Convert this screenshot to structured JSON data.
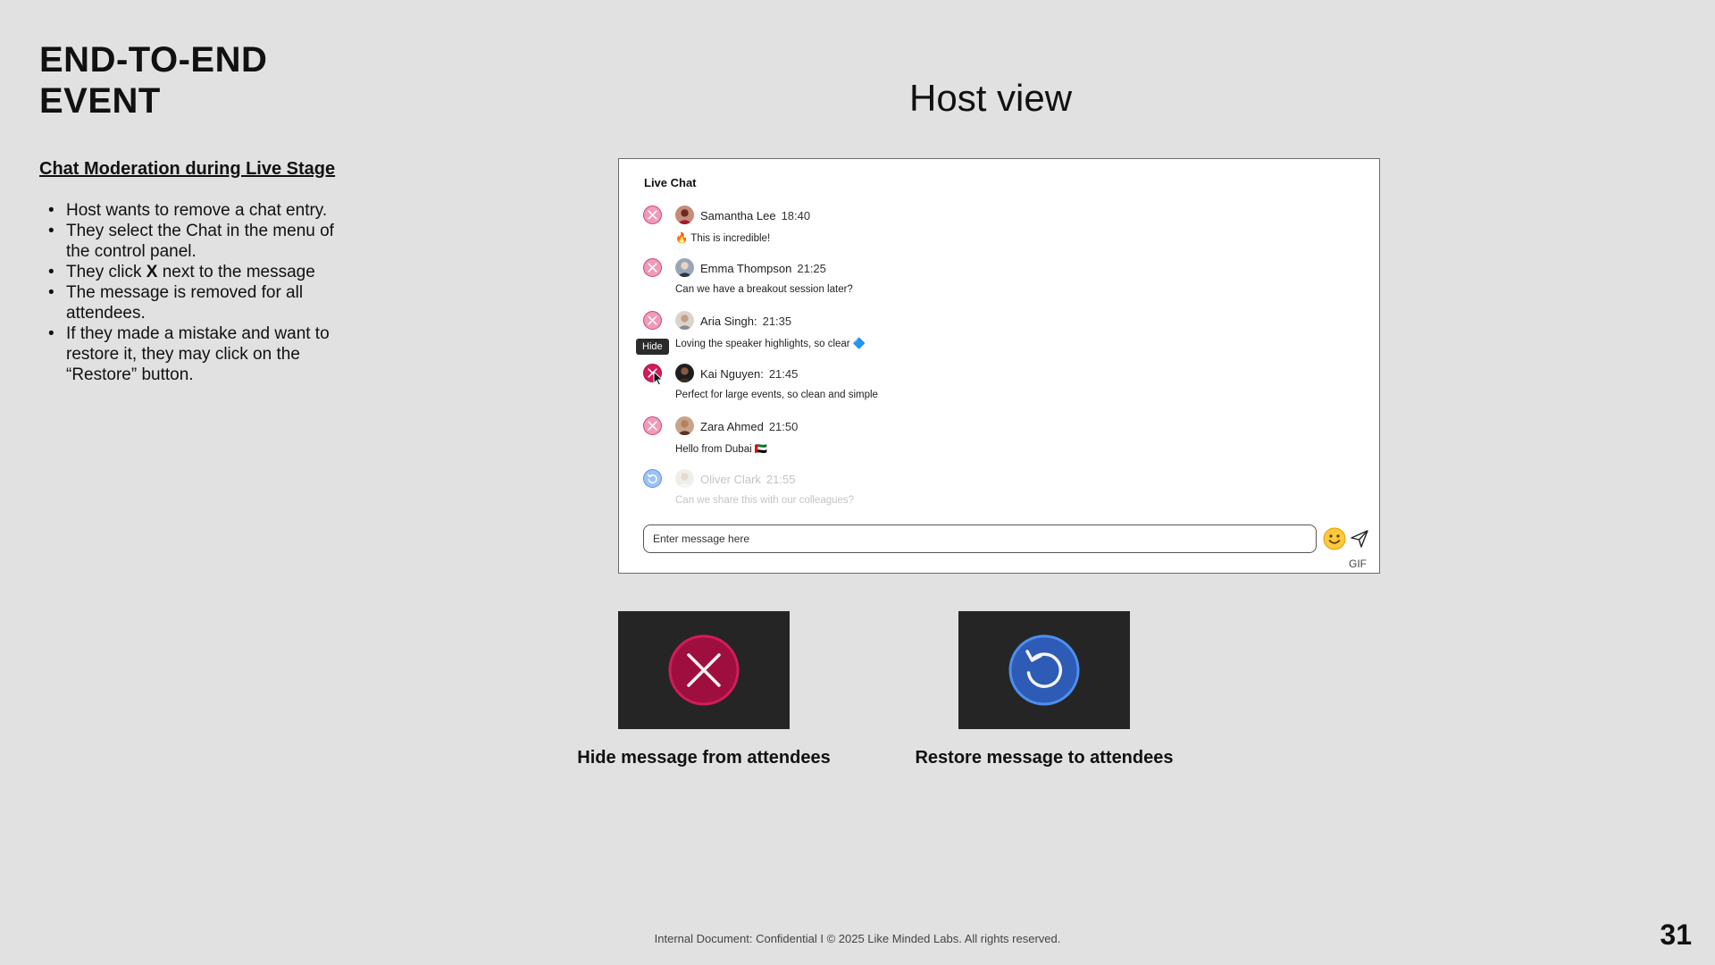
{
  "slide": {
    "title": "END-TO-END\nEVENT",
    "view_title": "Host view",
    "section_heading": "Chat Moderation during Live Stage",
    "bullets": [
      "Host wants to remove a chat entry.",
      "They select the Chat in the menu of the control panel.",
      {
        "before": "They click ",
        "bold": "X",
        "after": " next to the message"
      },
      "The message is removed for all attendees.",
      "If they made a mistake and want to restore it, they may click on the “Restore” button."
    ]
  },
  "chat": {
    "title": "Live Chat",
    "messages": [
      {
        "author": "Samantha Lee",
        "time": "18:40",
        "text": "🔥 This is incredible!",
        "state": "default"
      },
      {
        "author": "Emma Thompson",
        "time": "21:25",
        "text": "Can we have a breakout session later?",
        "state": "default"
      },
      {
        "author": "Aria Singh:",
        "time": "21:35",
        "text": "Loving the speaker highlights, so clear 🔷",
        "state": "default"
      },
      {
        "author": "Kai Nguyen:",
        "time": "21:45",
        "text": "Perfect for large events, so clean and simple",
        "state": "hover"
      },
      {
        "author": "Zara Ahmed",
        "time": "21:50",
        "text": "Hello from Dubai 🇦🇪",
        "state": "default"
      },
      {
        "author": "Oliver Clark",
        "time": "21:55",
        "text": "Can we share this with our colleagues?",
        "state": "hidden"
      }
    ],
    "tooltip": "Hide",
    "input_placeholder": "Enter message here",
    "gif_label": "GIF",
    "emoji_icon": "smiley-emoji-icon",
    "send_icon": "paper-plane-icon"
  },
  "legend": {
    "hide_caption": "Hide message from attendees",
    "restore_caption": "Restore message to attendees"
  },
  "colors": {
    "hide_accent": "#c0104a",
    "restore_accent": "#3f7fe0",
    "tile_bg": "#252526",
    "background": "#e1e1e1"
  },
  "footer": {
    "text": "Internal Document: Confidential  I  © 2025 Like Minded Labs. All rights reserved.",
    "page_number": "31"
  }
}
